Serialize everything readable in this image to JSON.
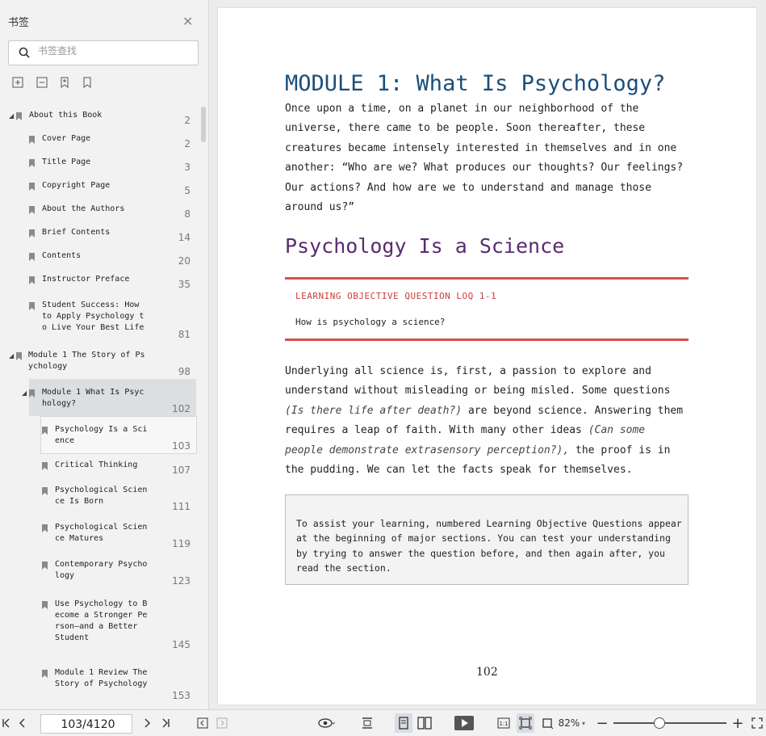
{
  "sidebar": {
    "title": "书签",
    "search_placeholder": "书签查找",
    "items": [
      {
        "label": "About this Book",
        "page": "2"
      },
      {
        "label": "Cover Page",
        "page": "2"
      },
      {
        "label": "Title Page",
        "page": "3"
      },
      {
        "label": "Copyright Page",
        "page": "5"
      },
      {
        "label": "About the Authors",
        "page": "8"
      },
      {
        "label": "Brief Contents",
        "page": "14"
      },
      {
        "label": "Contents",
        "page": "20"
      },
      {
        "label": "Instructor Preface",
        "page": "35"
      },
      {
        "label": "Student Success: How\nto Apply Psychology t\no Live Your Best Life",
        "page": "81"
      },
      {
        "label": "Module 1 The Story of Ps\nychology",
        "page": "98"
      },
      {
        "label": "Module 1 What Is Psyc\nhology?",
        "page": "102"
      },
      {
        "label": "Psychology Is a Sci\nence",
        "page": "103"
      },
      {
        "label": "Critical Thinking",
        "page": "107"
      },
      {
        "label": "Psychological Scien\nce Is Born",
        "page": "111"
      },
      {
        "label": "Psychological Scien\nce Matures",
        "page": "119"
      },
      {
        "label": "Contemporary Psycho\nlogy",
        "page": "123"
      },
      {
        "label": "Use Psychology to B\necome a Stronger Pe\nrson—and a Better\nStudent",
        "page": "145"
      },
      {
        "label": "Module 1 Review The\nStory of Psychology",
        "page": "153"
      }
    ]
  },
  "page": {
    "heading": "MODULE 1: What Is Psychology?",
    "intro": "Once upon a time, on a planet in our neighborhood of the universe, there came to be people. Soon thereafter, these creatures became intensely interested in themselves and in one another: “Who are we? What produces our thoughts? Our feelings? Our actions? And how are we to understand and manage those around us?”",
    "section_heading": "Psychology Is a Science",
    "loq_label": "LEARNING OBJECTIVE QUESTION LOQ 1-1",
    "loq_question": "How is psychology a science?",
    "para_start": "Underlying all science is, first, a passion to explore and understand without misleading or being misled. Some questions ",
    "para_italic1": "(Is there life after death?)",
    "para_mid": " are beyond science. Answering them requires a leap of faith. With many other ideas ",
    "para_italic2": "(Can some people demonstrate extrasensory perception?),",
    "para_end": " the proof is in the pudding. We can let the facts speak for themselves.",
    "box_text": "To assist your learning, numbered Learning Objective Questions appear at the beginning of major sections. You can test your understanding by trying to answer the question before, and then again after, you read the section.",
    "page_number": "102"
  },
  "toolbar": {
    "page_indicator": "103/4120",
    "zoom": "82%"
  }
}
